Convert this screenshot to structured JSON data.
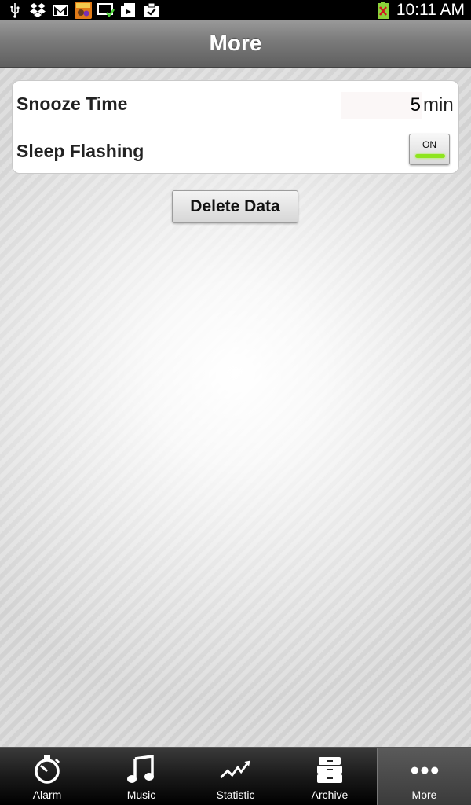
{
  "status_bar": {
    "time": "10:11 AM",
    "icons": [
      "usb-icon",
      "dropbox-icon",
      "gmail-icon",
      "game-app-icon",
      "screen-check-icon",
      "download-icon",
      "clipboard-check-icon",
      "battery-icon"
    ]
  },
  "header": {
    "title": "More"
  },
  "settings": {
    "snooze": {
      "label": "Snooze Time",
      "value": "5",
      "unit": "min"
    },
    "sleep_flashing": {
      "label": "Sleep Flashing",
      "toggle": "ON",
      "enabled": true
    }
  },
  "actions": {
    "delete_label": "Delete Data"
  },
  "tabs": [
    {
      "label": "Alarm",
      "icon": "alarm-clock-icon",
      "active": false
    },
    {
      "label": "Music",
      "icon": "music-note-icon",
      "active": false
    },
    {
      "label": "Statistic",
      "icon": "statistic-chart-icon",
      "active": false
    },
    {
      "label": "Archive",
      "icon": "archive-icon",
      "active": false
    },
    {
      "label": "More",
      "icon": "more-dots-icon",
      "active": true
    }
  ],
  "colors": {
    "toggle_on": "#8ee51d",
    "title_bar": "#7a7a7a"
  }
}
